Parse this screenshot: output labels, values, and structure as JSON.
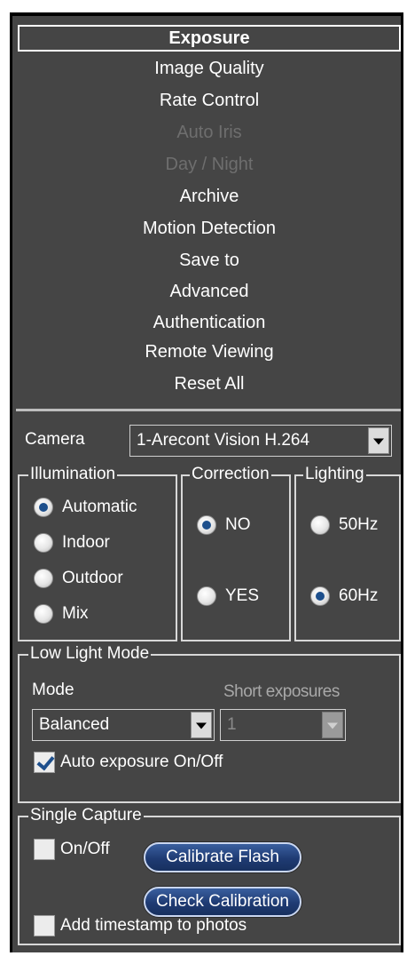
{
  "menu": {
    "items": [
      {
        "label": "Exposure",
        "state": "selected"
      },
      {
        "label": "Image Quality",
        "state": "normal"
      },
      {
        "label": "Rate Control",
        "state": "normal"
      },
      {
        "label": "Auto Iris",
        "state": "disabled"
      },
      {
        "label": "Day / Night",
        "state": "disabled"
      },
      {
        "label": "Archive",
        "state": "normal"
      },
      {
        "label": "Motion Detection",
        "state": "normal"
      },
      {
        "label": "Save to",
        "state": "normal"
      },
      {
        "label": "Advanced",
        "state": "normal"
      },
      {
        "label": "Authentication",
        "state": "normal"
      },
      {
        "label": "Remote Viewing",
        "state": "normal"
      },
      {
        "label": "Reset All",
        "state": "normal"
      }
    ]
  },
  "camera": {
    "label": "Camera",
    "selected": "1-Arecont Vision H.264"
  },
  "illumination": {
    "title": "Illumination",
    "options": [
      "Automatic",
      "Indoor",
      "Outdoor",
      "Mix"
    ],
    "selected": "Automatic"
  },
  "correction": {
    "title": "Correction",
    "options": [
      "NO",
      "YES"
    ],
    "selected": "NO"
  },
  "lighting": {
    "title": "Lighting",
    "options": [
      "50Hz",
      "60Hz"
    ],
    "selected": "60Hz"
  },
  "low_light": {
    "title": "Low Light Mode",
    "mode_label": "Mode",
    "mode_value": "Balanced",
    "short_label": "Short exposures",
    "short_value": "1",
    "auto_exposure_label": "Auto exposure On/Off",
    "auto_exposure_checked": true
  },
  "single_capture": {
    "title": "Single Capture",
    "onoff_label": "On/Off",
    "onoff_checked": false,
    "calibrate_label": "Calibrate Flash",
    "check_label": "Check Calibration",
    "timestamp_label": "Add timestamp to photos",
    "timestamp_checked": false
  },
  "colors": {
    "panel": "#454545",
    "accent": "#1d4f8c",
    "disabled_text": "#6e6e6e"
  }
}
